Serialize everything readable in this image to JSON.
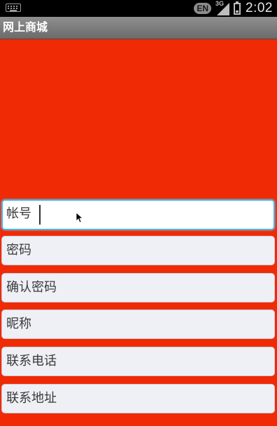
{
  "status_bar": {
    "input_icon": "keyboard-icon",
    "language": "EN",
    "network_type": "3G",
    "signal_icon": "signal-icon",
    "battery_icon": "battery-icon",
    "time": "2:02"
  },
  "app": {
    "title": "网上商城"
  },
  "form": {
    "account_placeholder": "帐号",
    "password_placeholder": "密码",
    "confirm_password_placeholder": "确认密码",
    "nickname_placeholder": "昵称",
    "phone_placeholder": "联系电话",
    "address_placeholder": "联系地址"
  },
  "colors": {
    "background": "#f02a05",
    "focus_border": "#45b4e8",
    "field_background": "#eef0f6"
  }
}
